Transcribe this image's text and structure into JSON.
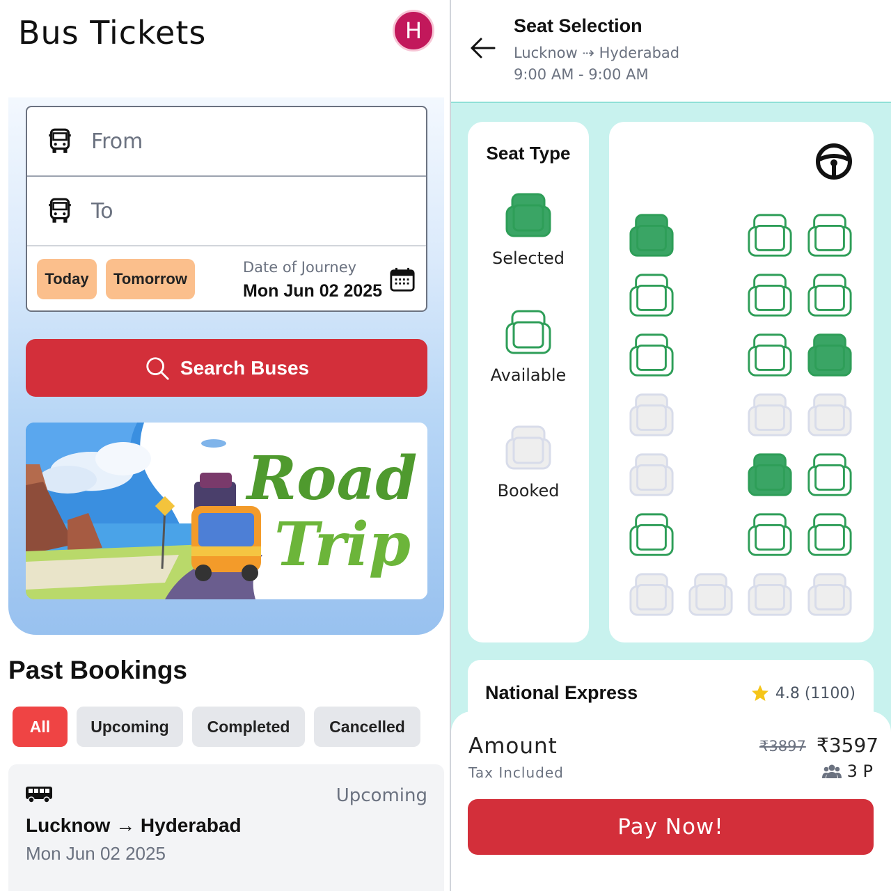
{
  "left": {
    "app_title": "Bus Tickets",
    "avatar_initial": "H",
    "form": {
      "from_placeholder": "From",
      "to_placeholder": "To",
      "today_label": "Today",
      "tomorrow_label": "Tomorrow",
      "date_label": "Date of Journey",
      "date_value": "Mon Jun 02 2025"
    },
    "search_button": "Search Buses",
    "banner_text_1": "Road",
    "banner_text_2": "Trip",
    "past_bookings": {
      "title": "Past Bookings",
      "filters": [
        "All",
        "Upcoming",
        "Completed",
        "Cancelled"
      ],
      "active_filter": "All",
      "booking": {
        "status": "Upcoming",
        "route": "Lucknow → Hyderabad",
        "date": "Mon Jun 02 2025"
      }
    }
  },
  "right": {
    "title": "Seat Selection",
    "route": "Lucknow ⇢ Hyderabad",
    "time": "9:00 AM - 9:00 AM",
    "legend": {
      "title": "Seat Type",
      "selected": "Selected",
      "available": "Available",
      "booked": "Booked"
    },
    "seat_rows": [
      [
        "selected",
        null,
        "available",
        "available"
      ],
      [
        "available",
        null,
        "available",
        "available"
      ],
      [
        "available",
        null,
        "available",
        "selected"
      ],
      [
        "booked",
        null,
        "booked",
        "booked"
      ],
      [
        "booked",
        null,
        "selected",
        "available"
      ],
      [
        "available",
        null,
        "available",
        "available"
      ],
      [
        "booked",
        "booked",
        "booked",
        "booked"
      ]
    ],
    "operator": {
      "name": "National Express",
      "rating": "4.8 (1100)"
    },
    "amount": {
      "label": "Amount",
      "tax_label": "Tax Included",
      "old_price": "₹3897",
      "new_price": "₹3597",
      "passengers": "3 P"
    },
    "pay_button": "Pay Now!"
  },
  "colors": {
    "primary_red": "#d32f3a",
    "filter_active": "#ef4444",
    "seat_green": "#2e9e58",
    "seat_selected_fill": "#3aa565",
    "booked_grey": "#d8dcea",
    "teal_bg": "#c8f2ee",
    "chip_orange": "#fbbf8c",
    "avatar": "#c2185b"
  }
}
